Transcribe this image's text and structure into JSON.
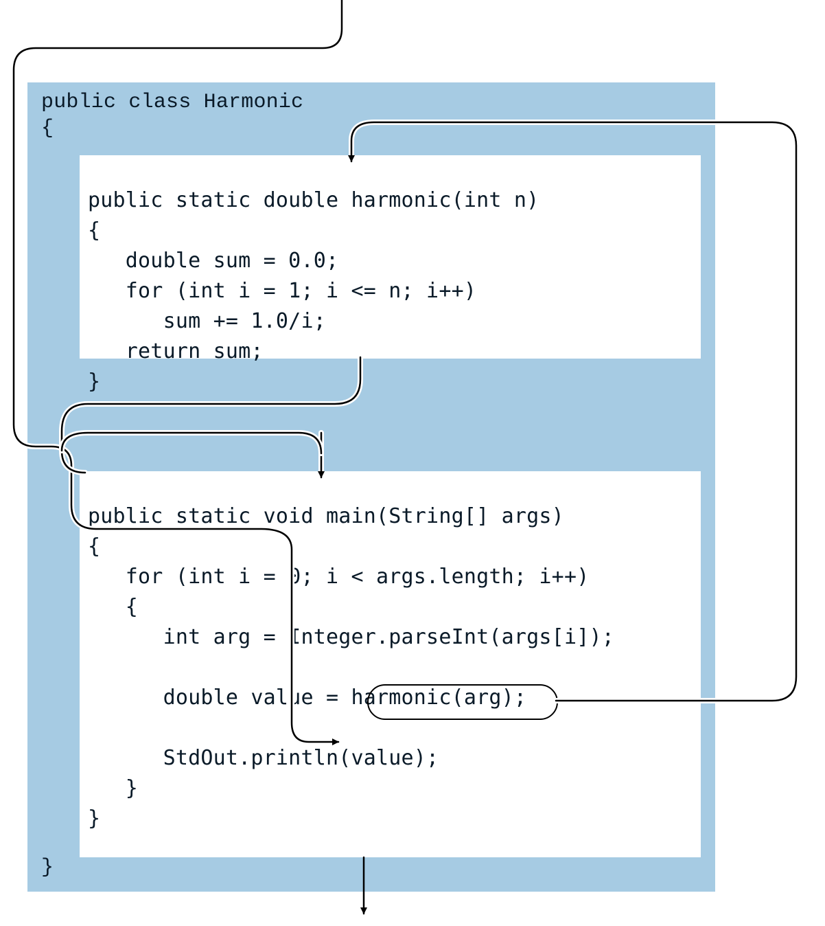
{
  "class_line1": "public class Harmonic",
  "class_line2": "{",
  "class_close": "}",
  "method1": "public static double harmonic(int n)\n{\n   double sum = 0.0;\n   for (int i = 1; i <= n; i++)\n      sum += 1.0/i;\n   return sum;\n}",
  "method2": "public static void main(String[] args)\n{\n   for (int i = 0; i < args.length; i++)\n   {\n      int arg = Integer.parseInt(args[i]);\n\n      double value = harmonic(arg);\n\n      StdOut.println(value);\n   }\n}",
  "call_highlight": "harmonic(arg);"
}
